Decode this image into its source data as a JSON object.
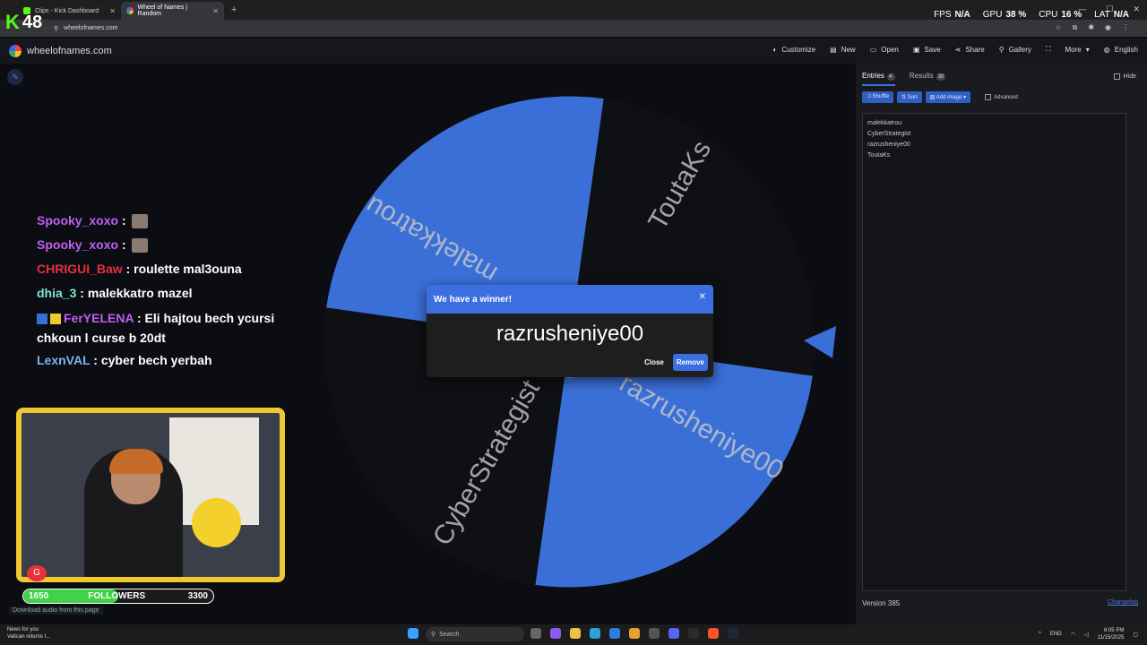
{
  "browser": {
    "tabs": [
      {
        "title": "Clips - Kick Dashboard"
      },
      {
        "title": "Wheel of Names | Random"
      }
    ],
    "url": "wheelofnames.com"
  },
  "overlay": {
    "viewer_count": "48",
    "perf": [
      {
        "label": "FPS",
        "value": "N/A"
      },
      {
        "label": "GPU",
        "value": "38 %"
      },
      {
        "label": "CPU",
        "value": "16 %"
      },
      {
        "label": "LAT",
        "value": "N/A"
      }
    ]
  },
  "app": {
    "site": "wheelofnames.com",
    "menu": [
      "Customize",
      "New",
      "Open",
      "Save",
      "Share",
      "Gallery",
      "More",
      "English"
    ]
  },
  "wheel": {
    "labels": [
      "malekkatrou",
      "ToutaKs",
      "razrusheniye00",
      "CyberStrategist"
    ],
    "colors": {
      "blue": "#3b6fd8",
      "black": "#0e1014"
    }
  },
  "dialog": {
    "title": "We have a winner!",
    "winner": "razrusheniye00",
    "close": "Close",
    "remove": "Remove"
  },
  "chat": [
    {
      "user": "Spooky_xoxo",
      "msg": ""
    },
    {
      "user": "Spooky_xoxo",
      "msg": ""
    },
    {
      "user": "CHRIGUI_Baw",
      "msg": "roulette mal3ouna"
    },
    {
      "user": "dhia_3",
      "msg": "malekkatro mazel"
    },
    {
      "user": "FerYELENA",
      "msg": "Eli hajtou bech ycursi chkoun l curse b 20dt"
    },
    {
      "user": "LexnVAL",
      "msg": "cyber bech yerbah"
    }
  ],
  "followers": {
    "current": "1650",
    "label": "FOLLOWERS",
    "goal": "3300",
    "progress": 0.5
  },
  "download_audio": "Download audio from this page",
  "panel": {
    "tabs": [
      {
        "label": "Entries",
        "count": "4"
      },
      {
        "label": "Results",
        "count": "30"
      }
    ],
    "hide": "Hide",
    "tools": [
      "Shuffle",
      "Sort",
      "Add image"
    ],
    "advanced": "Advanced",
    "entries": [
      "malekkatrou",
      "CyberStrategist",
      "razrusheniye00",
      "ToutaKs"
    ],
    "version": "Version 385",
    "changelog": "Changelog"
  },
  "taskbar": {
    "news_title": "News for you",
    "news_sub": "Vatican returns l...",
    "search": "Search",
    "lang": "ENG",
    "time": "6:05 PM",
    "date": "11/15/2025"
  }
}
